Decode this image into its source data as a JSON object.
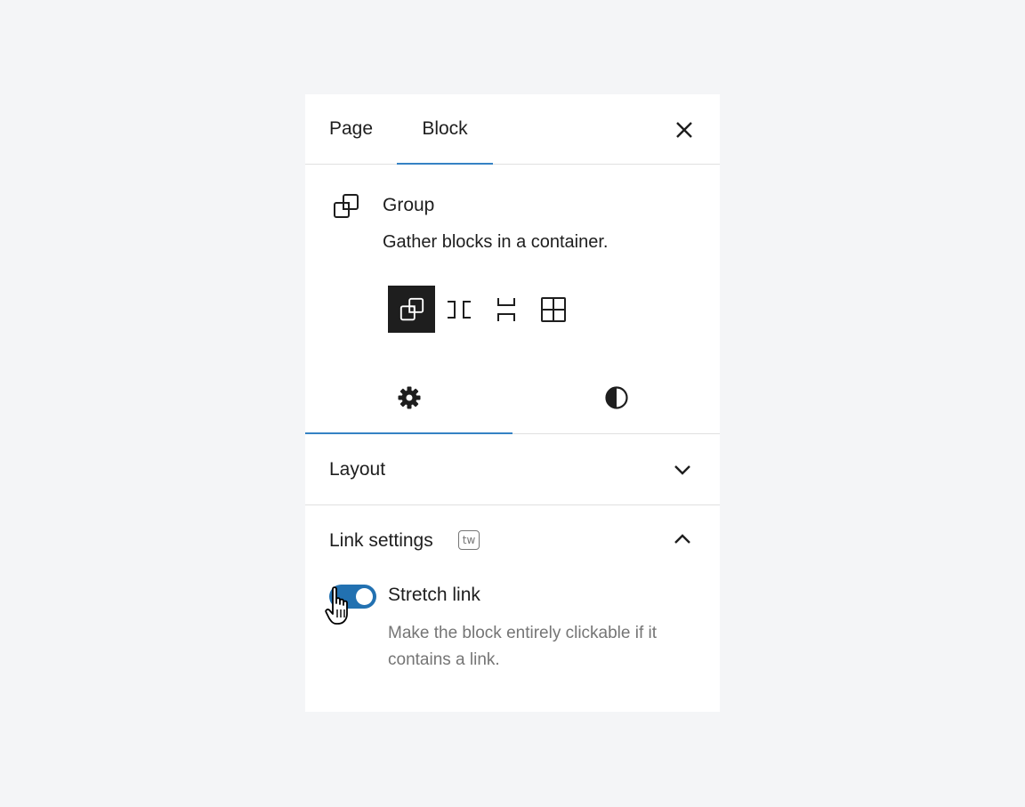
{
  "tabs": {
    "page_label": "Page",
    "block_label": "Block"
  },
  "block": {
    "title": "Group",
    "description": "Gather blocks in a container.",
    "variations": [
      "group",
      "row",
      "stack",
      "grid"
    ],
    "active_variation": "group"
  },
  "inspector_tabs": [
    "settings",
    "styles"
  ],
  "layout_panel": {
    "title": "Layout",
    "expanded": false
  },
  "link_panel": {
    "title": "Link settings",
    "badge": "tw",
    "expanded": true,
    "toggle_label": "Stretch link",
    "toggle_on": true,
    "help_text": "Make the block entirely clickable if it contains a link."
  },
  "colors": {
    "accent": "#3582c4",
    "toggle_on": "#2271b1",
    "active_variation_bg": "#1e1e1e",
    "background": "#f4f5f7"
  }
}
